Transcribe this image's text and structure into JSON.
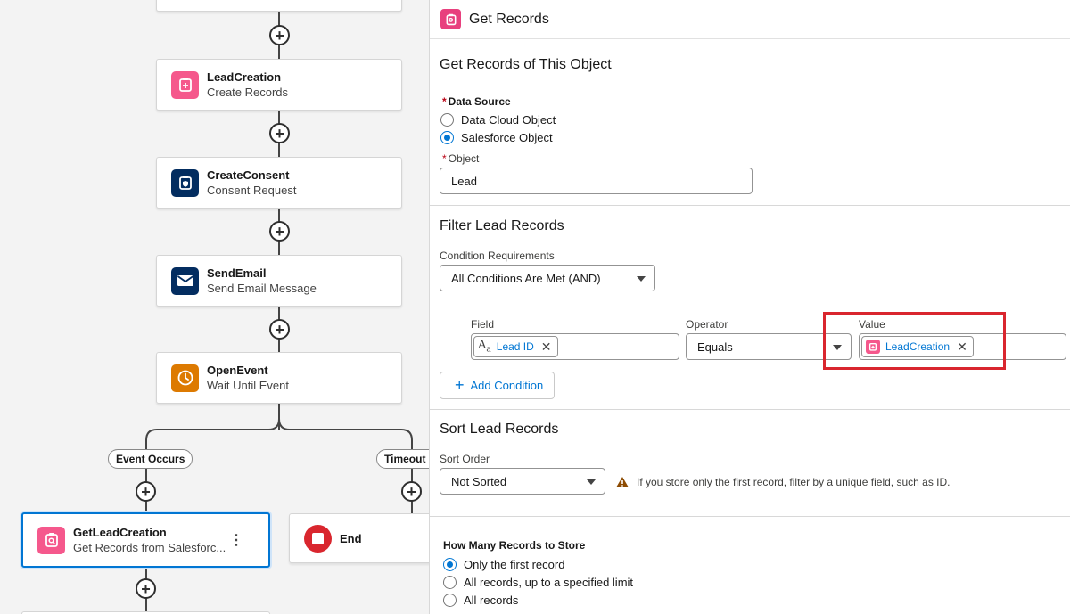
{
  "canvas": {
    "nodes": [
      {
        "title": "LeadCreation",
        "subtitle": "Create Records",
        "icon": "create-records-icon",
        "color": "#f5588c"
      },
      {
        "title": "CreateConsent",
        "subtitle": "Consent Request",
        "icon": "consent-shield-icon",
        "color": "#032d60"
      },
      {
        "title": "SendEmail",
        "subtitle": "Send Email Message",
        "icon": "envelope-icon",
        "color": "#032d60"
      },
      {
        "title": "OpenEvent",
        "subtitle": "Wait Until Event",
        "icon": "clock-icon",
        "color": "#dd7a01"
      }
    ],
    "branches": {
      "left": "Event Occurs",
      "right": "Timeout"
    },
    "selected_node": {
      "title": "GetLeadCreation",
      "subtitle": "Get Records from Salesforc...",
      "icon": "get-records-icon",
      "color": "#f5588c",
      "menu": "⋮"
    },
    "end_node": {
      "title": "End"
    }
  },
  "panel": {
    "title": "Get Records",
    "object_section": {
      "title": "Get Records of This Object",
      "data_source_label": "Data Source",
      "options": [
        "Data Cloud Object",
        "Salesforce Object"
      ],
      "selected_option": "Salesforce Object",
      "object_label": "Object",
      "object_value": "Lead"
    },
    "filter_section": {
      "title": "Filter Lead Records",
      "condition_label": "Condition Requirements",
      "condition_value": "All Conditions Are Met (AND)",
      "field_label": "Field",
      "field_value": "Lead ID",
      "operator_label": "Operator",
      "operator_value": "Equals",
      "value_label": "Value",
      "value_value": "LeadCreation",
      "add_condition": "Add Condition"
    },
    "sort_section": {
      "title": "Sort Lead Records",
      "sort_order_label": "Sort Order",
      "sort_order_value": "Not Sorted",
      "warning": "If you store only the first record, filter by a unique field, such as ID."
    },
    "store_section": {
      "title": "How Many Records to Store",
      "options": [
        "Only the first record",
        "All records, up to a specified limit",
        "All records"
      ],
      "selected_option": "Only the first record"
    }
  },
  "colors": {
    "accent": "#0176d3",
    "highlight": "#d9262e",
    "warning": "#8c4b02"
  }
}
